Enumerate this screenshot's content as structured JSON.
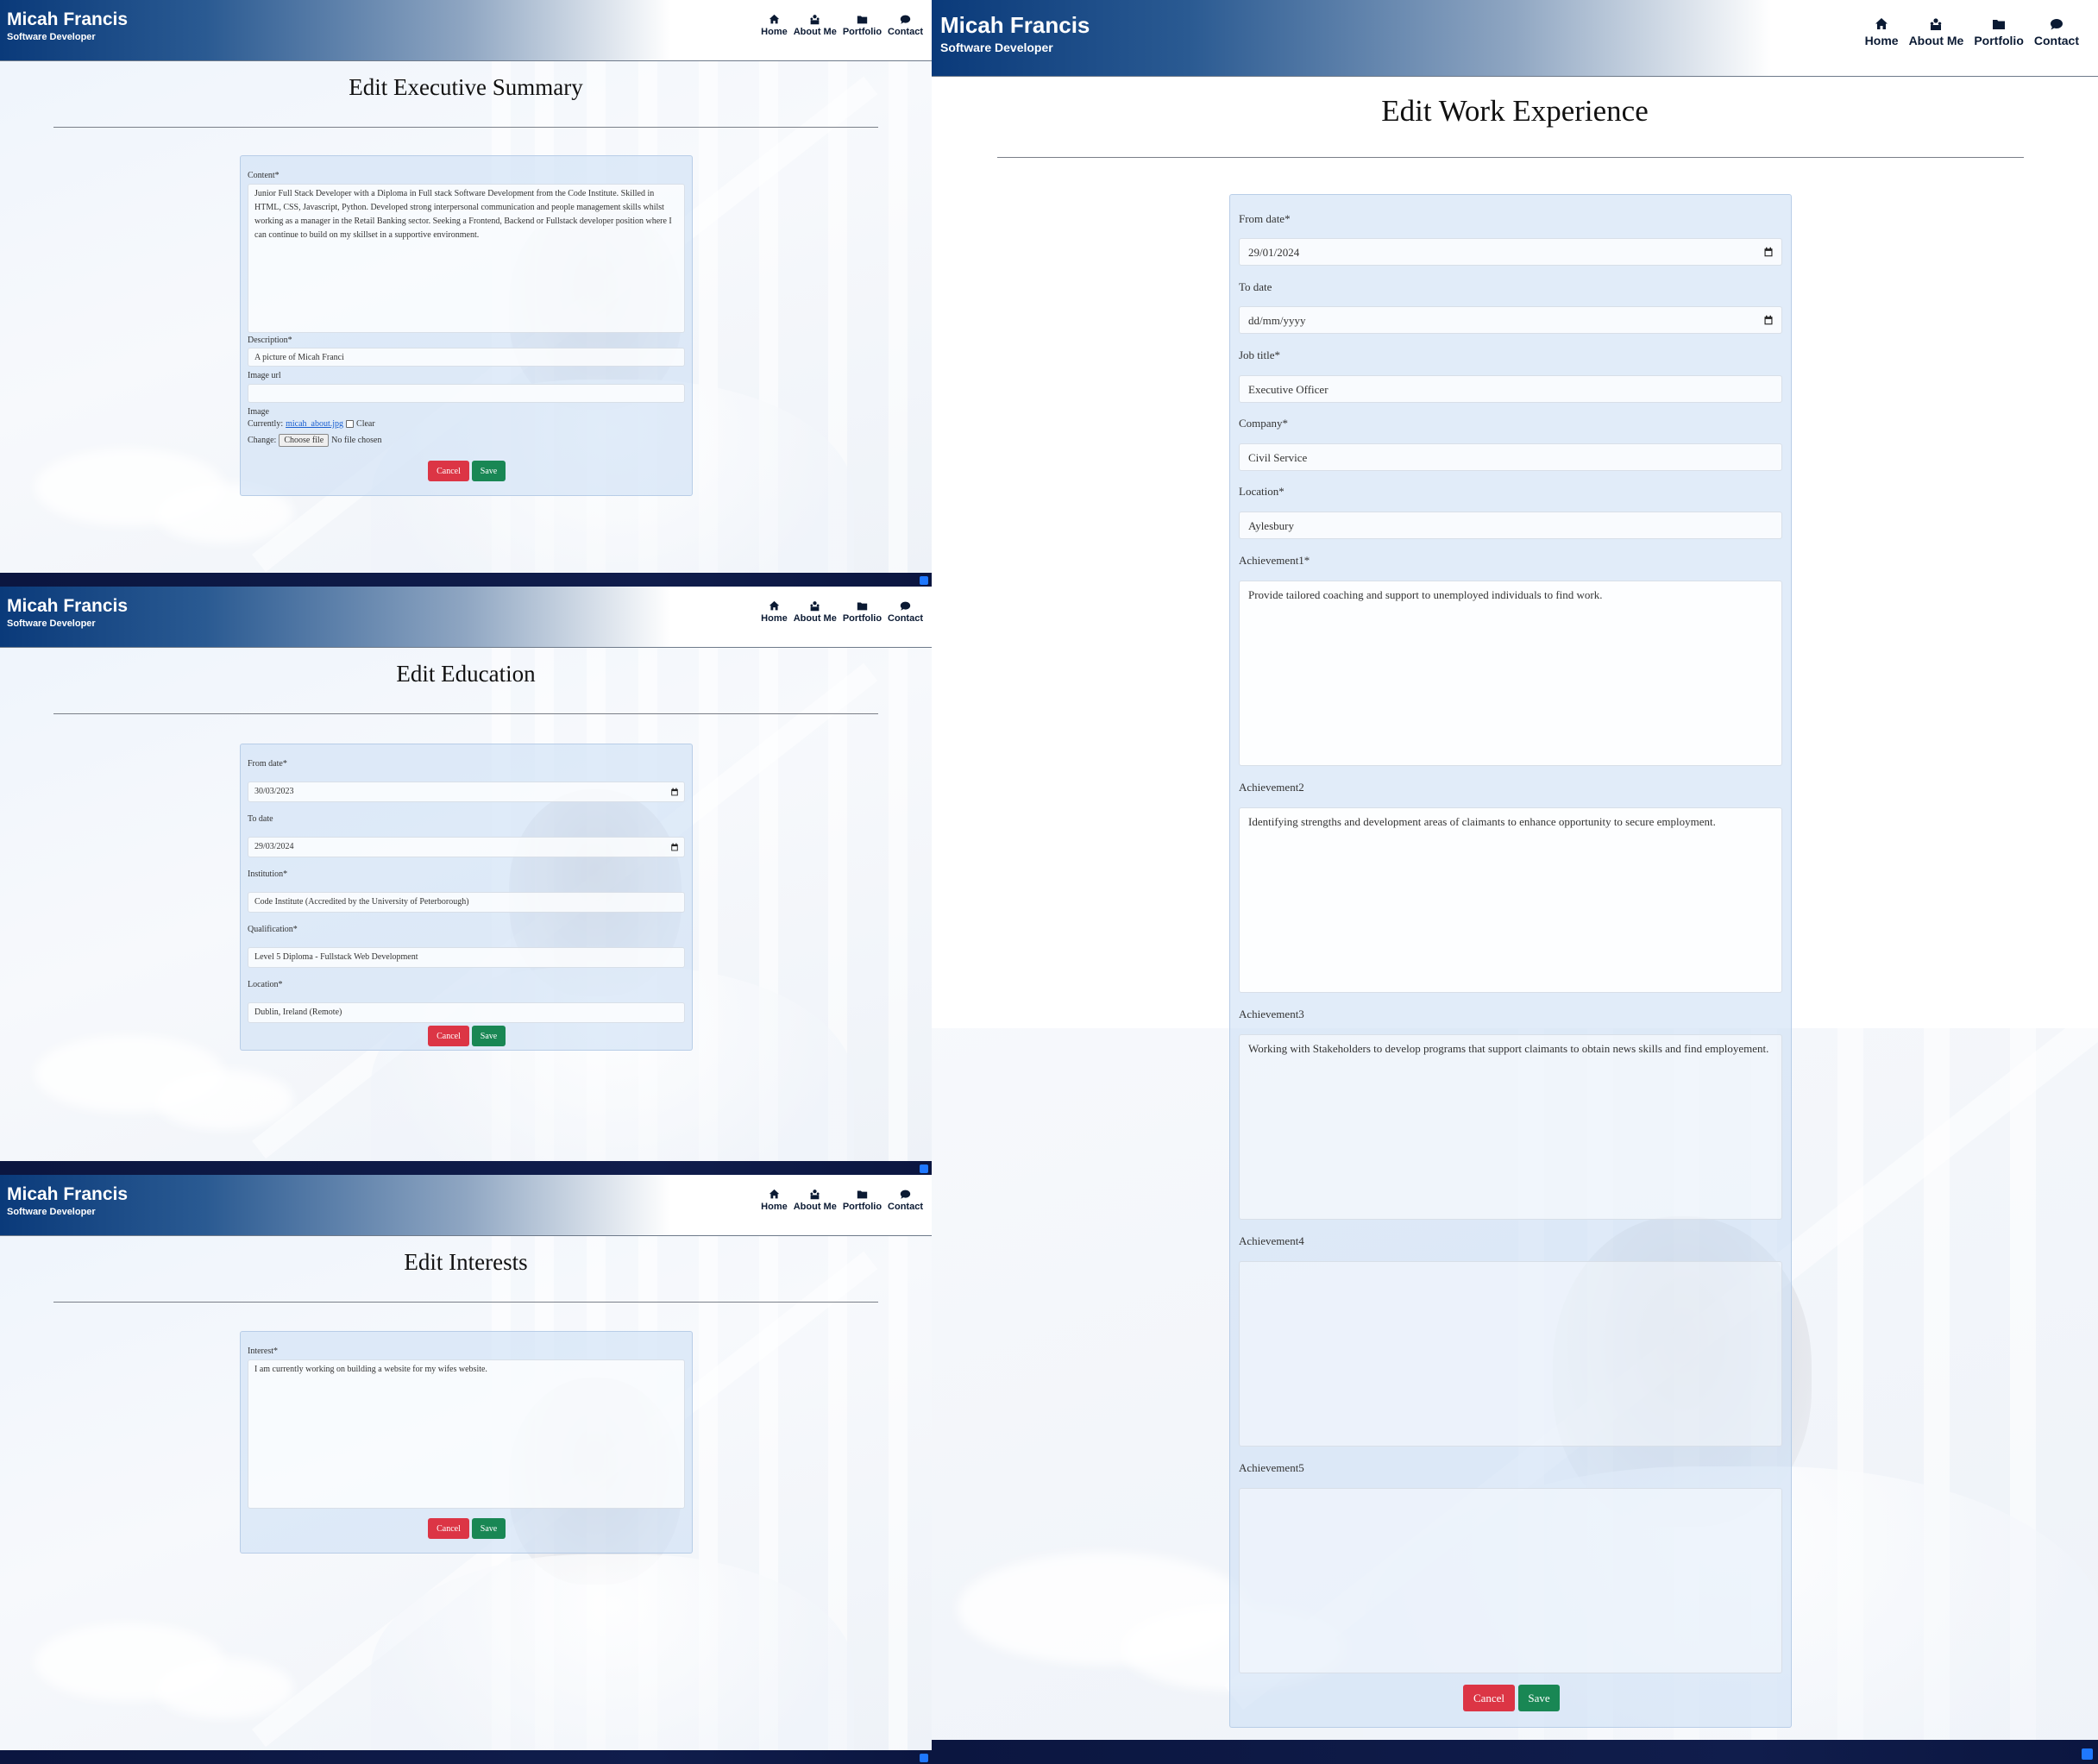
{
  "brand": {
    "name": "Micah Francis",
    "subtitle": "Software Developer"
  },
  "nav": [
    {
      "label": "Home",
      "icon": "home-icon"
    },
    {
      "label": "About Me",
      "icon": "about-me-icon"
    },
    {
      "label": "Portfolio",
      "icon": "folder-icon"
    },
    {
      "label": "Contact",
      "icon": "chat-icon"
    }
  ],
  "colors": {
    "navbar_start": "#0a3a7a",
    "cancel": "#dc3545",
    "save": "#198754",
    "footer": "#0b1640"
  },
  "buttons": {
    "cancel": "Cancel",
    "save": "Save"
  },
  "exec_summary": {
    "title": "Edit Executive Summary",
    "content_label": "Content*",
    "content_value": "Junior Full Stack Developer with a Diploma in Full stack Software Development from the Code Institute. Skilled in HTML, CSS, Javascript, Python. Developed strong interpersonal communication and people management skills whilst working as a manager in the Retail Banking sector. Seeking a Frontend, Backend or Fullstack developer position where I can continue to build on my skillset in a supportive environment.",
    "description_label": "Description*",
    "description_value": "A picture of Micah Franci",
    "image_url_label": "Image url",
    "image_url_value": "",
    "image_label": "Image",
    "currently_label": "Currently:",
    "current_file": "micah_about.jpg",
    "clear_label": "Clear",
    "change_label": "Change:",
    "choose_file": "Choose file",
    "no_file": "No file chosen"
  },
  "education": {
    "title": "Edit Education",
    "from_label": "From date*",
    "from_value": "30/03/2023",
    "to_label": "To date",
    "to_value": "29/03/2024",
    "institution_label": "Institution*",
    "institution_value": "Code Institute (Accredited by the University of Peterborough)",
    "qualification_label": "Qualification*",
    "qualification_value": "Level 5 Diploma - Fullstack Web Development",
    "location_label": "Location*",
    "location_value": "Dublin, Ireland (Remote)"
  },
  "interests": {
    "title": "Edit Interests",
    "interest_label": "Interest*",
    "interest_value": "I am currently working on building a website for my wifes website."
  },
  "work": {
    "title": "Edit Work Experience",
    "from_label": "From date*",
    "from_value": "29/01/2024",
    "to_label": "To date",
    "to_value": "dd/mm/yyyy",
    "job_title_label": "Job title*",
    "job_title_value": "Executive Officer",
    "company_label": "Company*",
    "company_value": "Civil Service",
    "location_label": "Location*",
    "location_value": "Aylesbury",
    "achievement1_label": "Achievement1*",
    "achievement1_value": "Provide tailored coaching and support to unemployed individuals to find work.",
    "achievement2_label": "Achievement2",
    "achievement2_value": "Identifying strengths and development areas of claimants to enhance opportunity to secure employment.",
    "achievement3_label": "Achievement3",
    "achievement3_value": "Working with Stakeholders to develop programs that support claimants to obtain news skills and find employement.",
    "achievement4_label": "Achievement4",
    "achievement4_value": "",
    "achievement5_label": "Achievement5",
    "achievement5_value": ""
  }
}
